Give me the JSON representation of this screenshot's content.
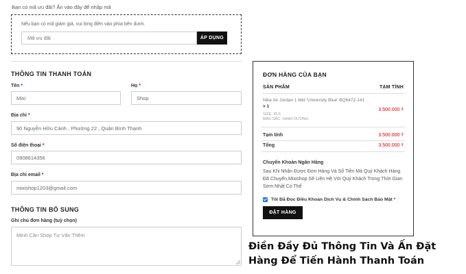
{
  "coupon": {
    "notice": "Bạn có mã ưu đãi? Ấn vào đây để nhập mã",
    "description": "Nếu bạn có mã giảm giá, vui lòng điền vào phía bên dưới.",
    "placeholder": "Mã ưu đãi",
    "apply_label": "ÁP DỤNG"
  },
  "billing": {
    "title": "THÔNG TIN THANH TOÁN",
    "first_name": {
      "label": "Tên",
      "required": "*",
      "value": "Mixi"
    },
    "last_name": {
      "label": "Họ",
      "required": "*",
      "value": "Shop"
    },
    "address": {
      "label": "Địa chỉ",
      "required": "*",
      "value": "90 Nguyễn Hữu Cảnh , Phường 22 , Quận Bình Thạnh"
    },
    "phone": {
      "label": "Số điện thoại",
      "required": "*",
      "value": "0908614356"
    },
    "email": {
      "label": "Địa chỉ email",
      "required": "*",
      "value": "mixishop1203@gmail.com"
    }
  },
  "additional": {
    "title": "THÔNG TIN BỔ SUNG",
    "notes_label": "Ghi chú đơn hàng (tuỳ chọn)",
    "notes_value": "Minh Cần Shop Tư Vấn Thêm"
  },
  "order": {
    "title": "ĐƠN HÀNG CỦA BẠN",
    "col_product": "SẢN PHẨM",
    "col_subtotal": "TẠM TÍNH",
    "product_name": "Nike Air Jordan 1 Mid 'University Blue' BQ6472-141",
    "product_qty": "× 1",
    "product_size": "SIZE: 35.5",
    "product_color": "MÀU SẮC: XANH DƯƠNG",
    "product_price": "3.500.000 ₫",
    "subtotal_label": "Tạm tính",
    "subtotal_value": "3.500.000 ₫",
    "total_label": "Tổng",
    "total_value": "3.500.000 ₫",
    "payment_title": "Chuyển Khoản Ngân Hàng",
    "payment_desc": "Sau Khi Nhận Được Đơn Hàng Và Số Tiền Mà Quý Khách Hàng Đã Chuyển,Mixishop Sẽ Liên Hệ Với Quý Khách Trong Thời Gian Sớm Nhất Có Thể",
    "terms_label": "Tôi Đã Đọc Điều Khoản Dịch Vụ & Chính Sách Bảo Mật",
    "terms_required": "*",
    "terms_checked": true,
    "place_order_label": "ĐẶT HÀNG"
  },
  "caption": "Điền Đầy Đủ Thông Tin Và Ấn Đặt Hàng Để Tiến Hành Thanh Toán",
  "colors": {
    "accent_price": "#dd0000",
    "button_bg": "#111111",
    "checkbox": "#1a73e8"
  }
}
